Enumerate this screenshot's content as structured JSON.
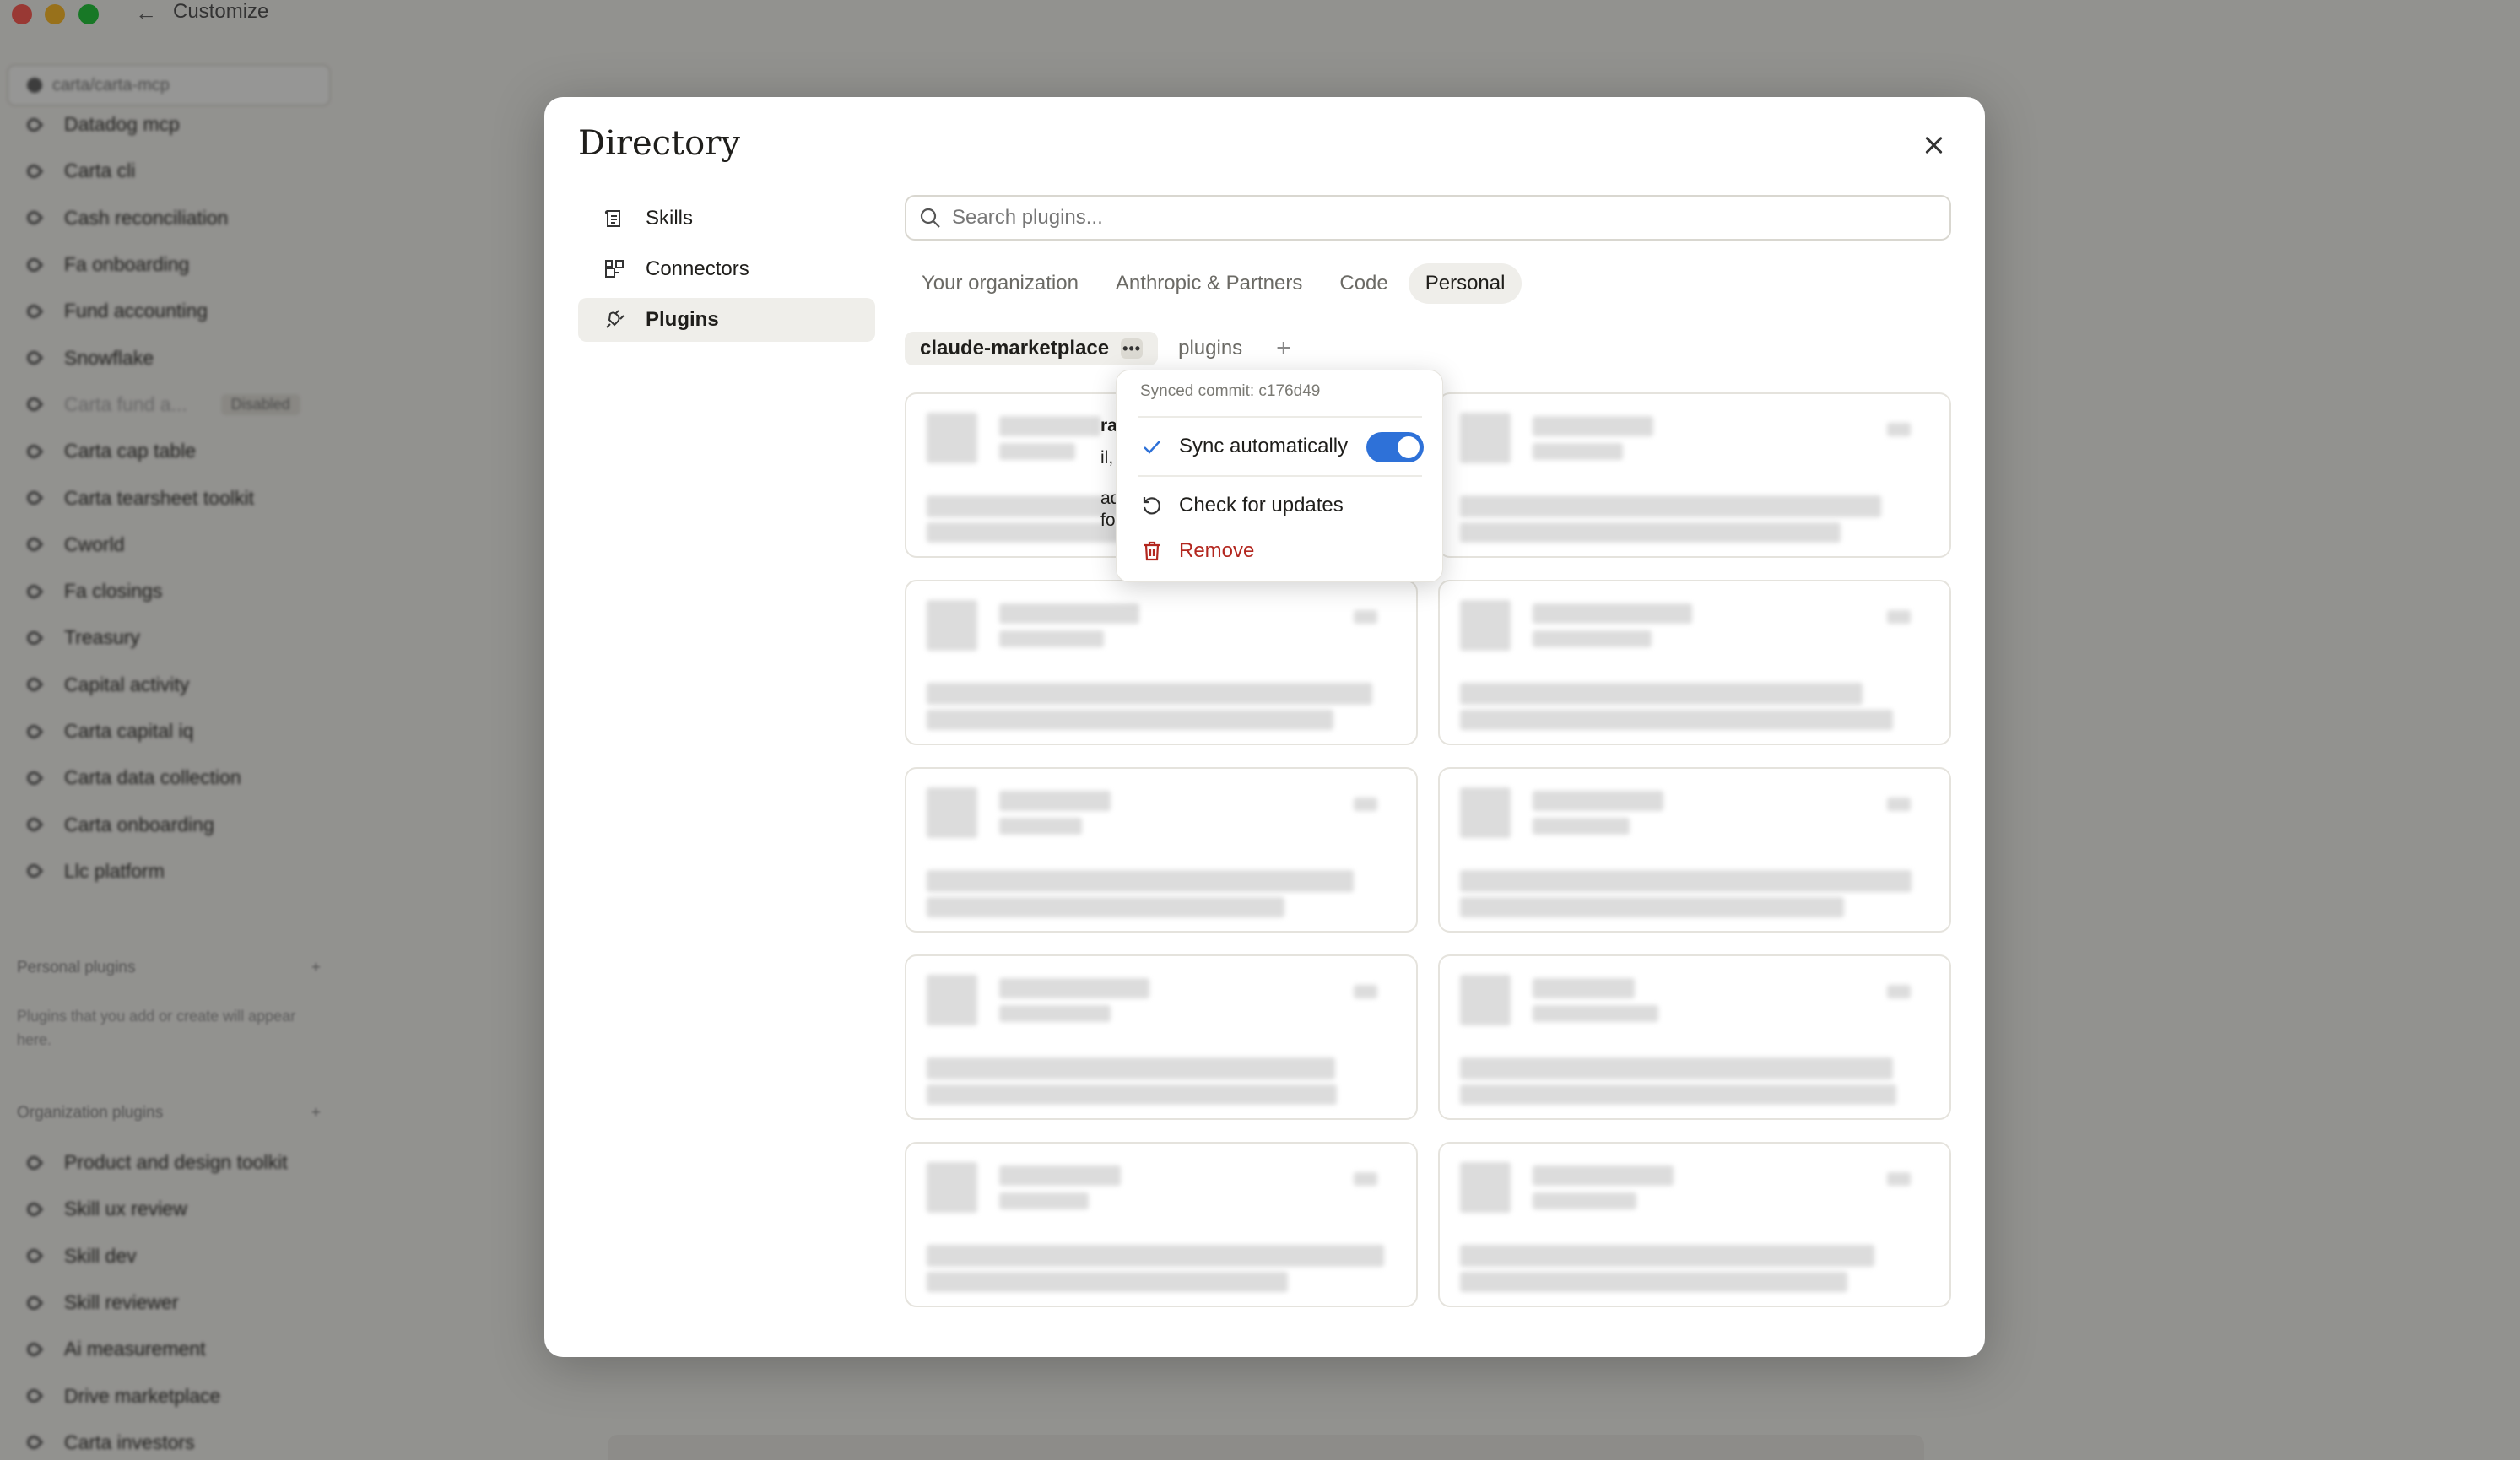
{
  "window": {
    "title": "Customize"
  },
  "app_sidebar": {
    "repo": "carta/carta-mcp",
    "items": [
      {
        "label": "Datadog mcp"
      },
      {
        "label": "Carta cli"
      },
      {
        "label": "Cash reconciliation"
      },
      {
        "label": "Fa onboarding"
      },
      {
        "label": "Fund accounting"
      },
      {
        "label": "Snowflake"
      },
      {
        "label": "Carta fund a...",
        "badge": "Disabled",
        "disabled": true
      },
      {
        "label": "Carta cap table"
      },
      {
        "label": "Carta tearsheet toolkit"
      },
      {
        "label": "Cworld"
      },
      {
        "label": "Fa closings"
      },
      {
        "label": "Treasury"
      },
      {
        "label": "Capital activity"
      },
      {
        "label": "Carta capital iq"
      },
      {
        "label": "Carta data collection"
      },
      {
        "label": "Carta onboarding"
      },
      {
        "label": "Llc platform"
      }
    ],
    "personal_section": "Personal plugins",
    "personal_note": "Plugins that you add or create will appear here.",
    "org_section": "Organization plugins",
    "org_items": [
      {
        "label": "Product and design toolkit"
      },
      {
        "label": "Skill ux review"
      },
      {
        "label": "Skill dev"
      },
      {
        "label": "Skill reviewer"
      },
      {
        "label": "Ai measurement"
      },
      {
        "label": "Drive marketplace"
      },
      {
        "label": "Carta investors"
      }
    ]
  },
  "modal": {
    "title": "Directory",
    "nav": [
      {
        "label": "Skills",
        "icon": "skills-icon"
      },
      {
        "label": "Connectors",
        "icon": "connectors-icon"
      },
      {
        "label": "Plugins",
        "icon": "plug-icon",
        "active": true
      }
    ],
    "search_placeholder": "Search plugins...",
    "tabs": [
      {
        "label": "Your organization"
      },
      {
        "label": "Anthropic & Partners"
      },
      {
        "label": "Code"
      },
      {
        "label": "Personal",
        "active": true
      }
    ],
    "marketplaces": [
      {
        "label": "claude-marketplace",
        "active": true
      },
      {
        "label": "plugins"
      }
    ],
    "add_symbol": "+",
    "peek": {
      "title_fragment": "ra",
      "line1": "il,",
      "line2": "ad",
      "line3": "fo"
    }
  },
  "popover": {
    "synced_commit": "Synced commit: c176d49",
    "sync_label": "Sync automatically",
    "sync_enabled": true,
    "check_label": "Check for updates",
    "remove_label": "Remove"
  },
  "colors": {
    "accent": "#2e71d8",
    "danger": "#b3261e"
  }
}
